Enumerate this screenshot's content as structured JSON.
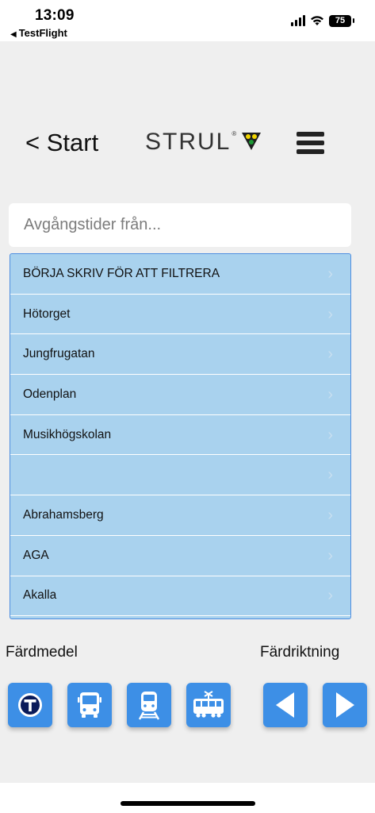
{
  "status_bar": {
    "time": "13:09",
    "back_app": "TestFlight",
    "battery": "75"
  },
  "header": {
    "back_label": "< Start",
    "logo_text": "STRUL",
    "logo_reg": "®"
  },
  "search": {
    "placeholder": "Avgångstider från..."
  },
  "stations": [
    {
      "label": "BÖRJA SKRIV FÖR ATT FILTRERA"
    },
    {
      "label": "Hötorget"
    },
    {
      "label": "Jungfrugatan"
    },
    {
      "label": "Odenplan"
    },
    {
      "label": "Musikhögskolan"
    },
    {
      "label": ""
    },
    {
      "label": "Abrahamsberg"
    },
    {
      "label": "AGA"
    },
    {
      "label": "Akalla"
    }
  ],
  "labels": {
    "mode": "Färdmedel",
    "direction": "Färdriktning"
  },
  "transport_modes": [
    {
      "icon": "metro-icon"
    },
    {
      "icon": "bus-icon"
    },
    {
      "icon": "train-icon"
    },
    {
      "icon": "tram-icon"
    }
  ],
  "colors": {
    "button_blue": "#3d8fe6",
    "list_bg": "#a9d2ee",
    "logo_green": "#1c9a34",
    "logo_yellow": "#f2d500"
  }
}
